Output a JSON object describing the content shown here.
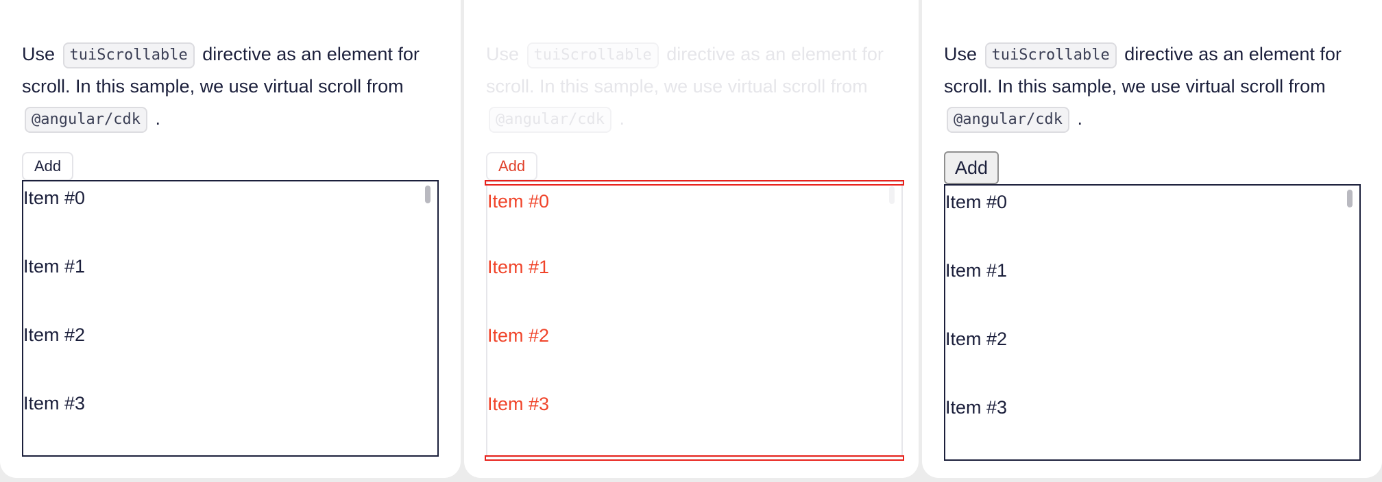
{
  "panels": [
    {
      "description": {
        "before_code1": "Use ",
        "code1": "tuiScrollable",
        "between": " directive as an element for scroll. In this sample, we use virtual scroll from ",
        "code2": "@angular/cdk",
        "after": " ."
      },
      "add_label": "Add",
      "items": [
        "Item #0",
        "Item #1",
        "Item #2",
        "Item #3"
      ]
    },
    {
      "description": {
        "before_code1": "Use ",
        "code1": "tuiScrollable",
        "between": " directive as an element for scroll. In this sample, we use virtual scroll from ",
        "code2": "@angular/cdk",
        "after": " ."
      },
      "add_label": "Add",
      "items": [
        "Item #0",
        "Item #1",
        "Item #2",
        "Item #3"
      ]
    },
    {
      "description": {
        "before_code1": "Use ",
        "code1": "tuiScrollable",
        "between": " directive as an element for scroll. In this sample, we use virtual scroll from ",
        "code2": "@angular/cdk",
        "after": " ."
      },
      "add_label": "Add",
      "items": [
        "Item #0",
        "Item #1",
        "Item #2",
        "Item #3"
      ]
    }
  ],
  "colors": {
    "text": "#1b1f3b",
    "diff_highlight": "#e8201a",
    "background": "#ececec"
  }
}
